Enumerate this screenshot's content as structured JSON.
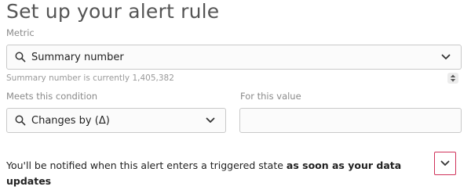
{
  "page": {
    "title": "Set up your alert rule"
  },
  "metric": {
    "label": "Metric",
    "selected": "Summary number",
    "helper": "Summary number is currently 1,405,382"
  },
  "condition": {
    "label": "Meets this condition",
    "selected": "Changes by (Δ)"
  },
  "value": {
    "label": "For this value",
    "input_value": ""
  },
  "notice": {
    "text_prefix": "You'll be notified when this alert enters a triggered state ",
    "text_bold": "as soon as your data updates"
  },
  "colors": {
    "accent_border": "#d0325a"
  },
  "icons": {
    "search": "search-icon",
    "dropdown": "chevron-down-icon",
    "stepper": "stepper-icon"
  }
}
